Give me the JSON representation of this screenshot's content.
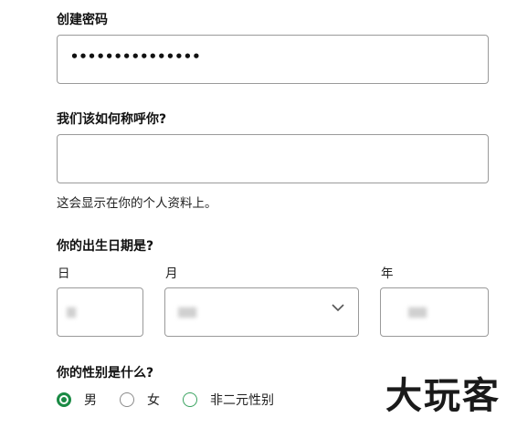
{
  "password": {
    "label": "创建密码",
    "value": "•••••••••••••••"
  },
  "display_name": {
    "label": "我们该如何称呼你?",
    "value": "",
    "hint": "这会显示在你的个人资料上。"
  },
  "birthday": {
    "label": "你的出生日期是?",
    "day_label": "日",
    "month_label": "月",
    "year_label": "年"
  },
  "gender": {
    "label": "你的性别是什么?",
    "options": [
      {
        "label": "男",
        "selected": true
      },
      {
        "label": "女",
        "selected": false
      },
      {
        "label": "非二元性别",
        "selected": false
      }
    ]
  },
  "watermark": "大玩客",
  "colors": {
    "accent": "#1a8a44",
    "border": "#9a9a9a"
  }
}
